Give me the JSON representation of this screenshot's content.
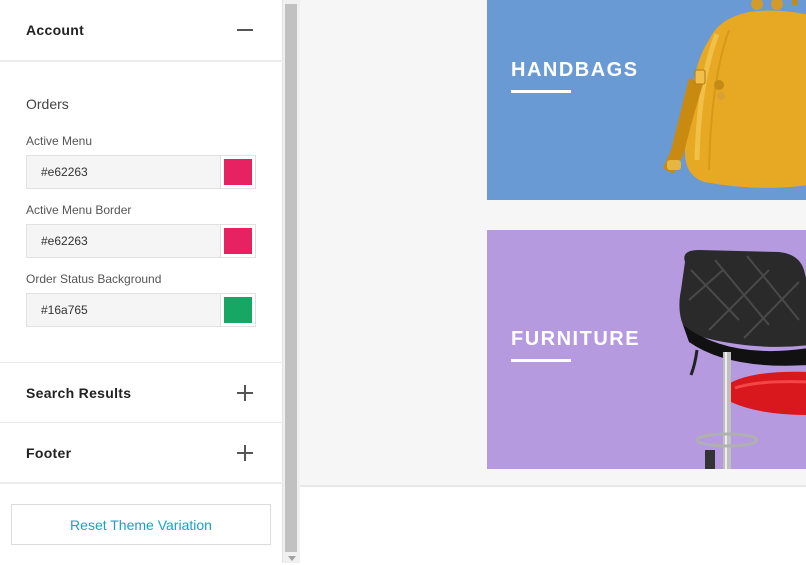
{
  "sidebar": {
    "account": {
      "title": "Account",
      "state": "expanded"
    },
    "orders": {
      "title": "Orders",
      "fields": [
        {
          "label": "Active Menu",
          "value": "#e62263",
          "color": "#e62263"
        },
        {
          "label": "Active Menu Border",
          "value": "#e62263",
          "color": "#e62263"
        },
        {
          "label": "Order Status Background",
          "value": "#16a765",
          "color": "#16a765"
        }
      ]
    },
    "search_results": {
      "title": "Search Results",
      "state": "collapsed"
    },
    "footer": {
      "title": "Footer",
      "state": "collapsed"
    },
    "reset_button": "Reset Theme Variation"
  },
  "preview": {
    "banners": [
      {
        "label": "HANDBAGS",
        "background": "#6a9ad4"
      },
      {
        "label": "FURNITURE",
        "background": "#b59ae0"
      }
    ]
  },
  "icons": [
    "minus-icon",
    "plus-icon",
    "handbag-image",
    "chair-image"
  ]
}
